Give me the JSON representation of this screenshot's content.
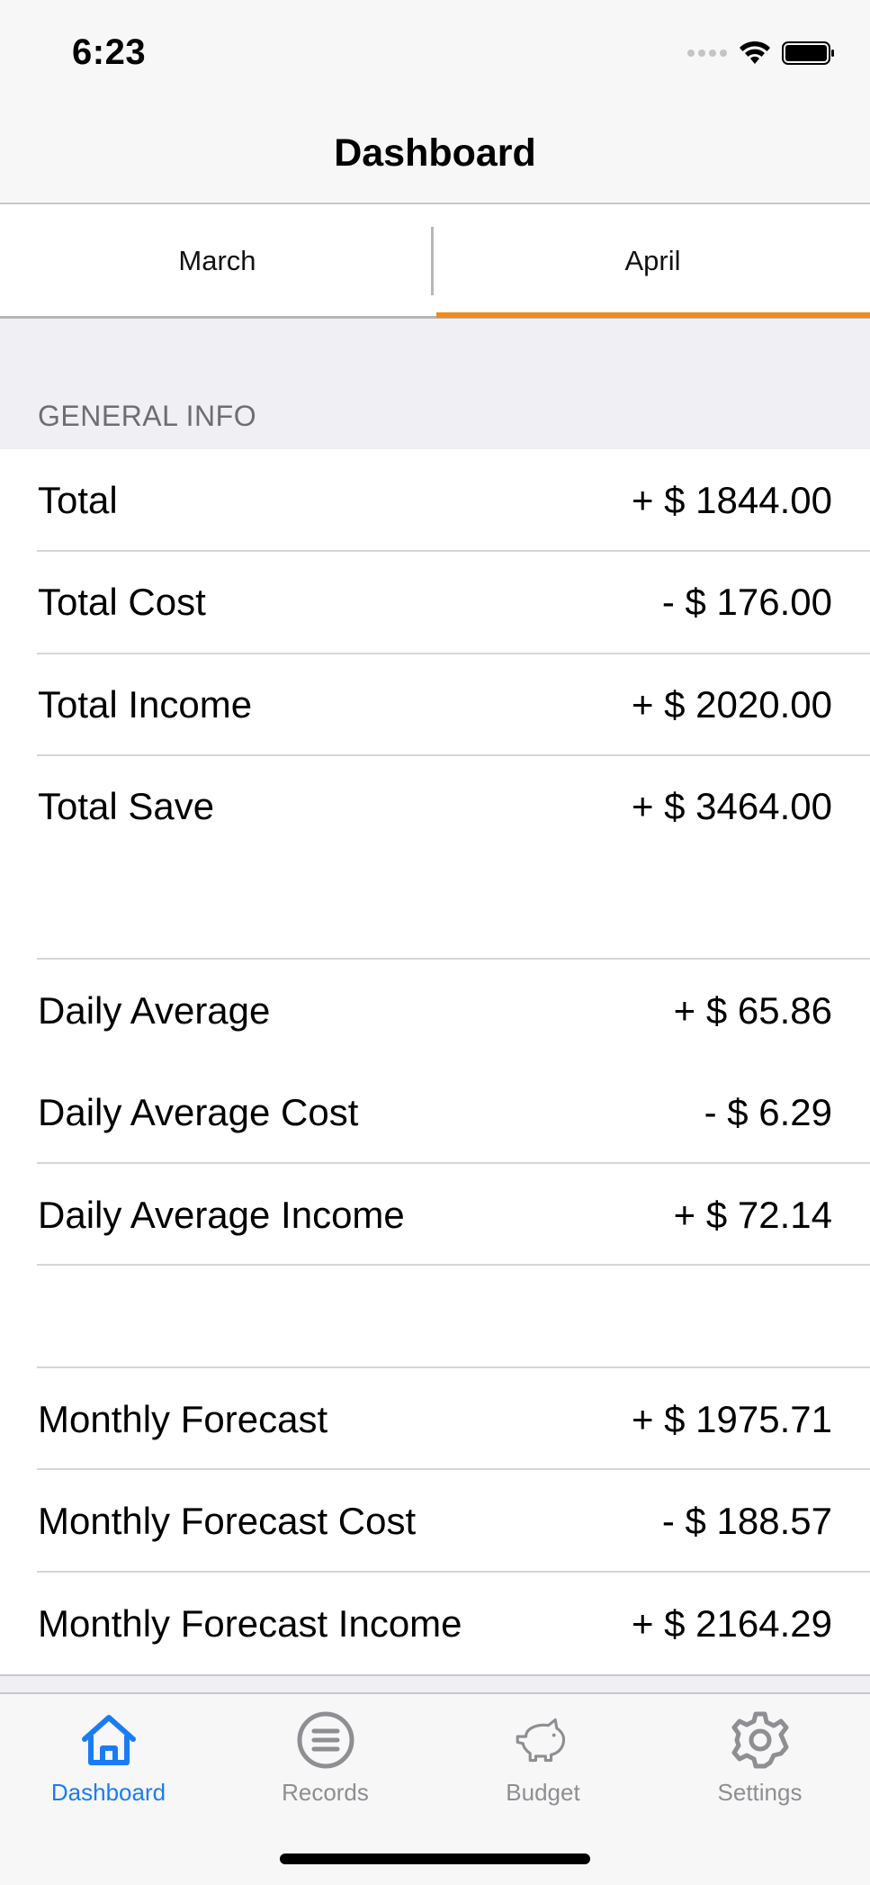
{
  "status_bar": {
    "time": "6:23",
    "icons": [
      "cellular-signal-icon",
      "wifi-icon",
      "battery-icon"
    ]
  },
  "nav": {
    "title": "Dashboard"
  },
  "segments": {
    "items": [
      "March",
      "April"
    ],
    "selected": "April",
    "accent_color": "#ee8a22"
  },
  "section": {
    "header": "GENERAL INFO"
  },
  "rows": [
    {
      "label": "Total",
      "value": "+ $ 1844.00"
    },
    {
      "label": "Total Cost",
      "value": "- $ 176.00"
    },
    {
      "label": "Total Income",
      "value": "+ $ 2020.00"
    },
    {
      "label": "Total Save",
      "value": "+ $ 3464.00"
    },
    {
      "label": "Daily Average",
      "value": "+ $ 65.86"
    },
    {
      "label": "Daily Average Cost",
      "value": "- $ 6.29"
    },
    {
      "label": "Daily Average Income",
      "value": "+ $ 72.14"
    },
    {
      "label": "Monthly Forecast",
      "value": "+ $ 1975.71"
    },
    {
      "label": "Monthly Forecast Cost",
      "value": "- $ 188.57"
    },
    {
      "label": "Monthly Forecast Income",
      "value": "+ $ 2164.29"
    }
  ],
  "tabbar": {
    "items": [
      {
        "label": "Dashboard",
        "icon": "home-icon",
        "active": true
      },
      {
        "label": "Records",
        "icon": "list-icon",
        "active": false
      },
      {
        "label": "Budget",
        "icon": "piggy-bank-icon",
        "active": false
      },
      {
        "label": "Settings",
        "icon": "gear-icon",
        "active": false
      }
    ],
    "active_color": "#1a7cf3",
    "inactive_color": "#8e8e93"
  }
}
